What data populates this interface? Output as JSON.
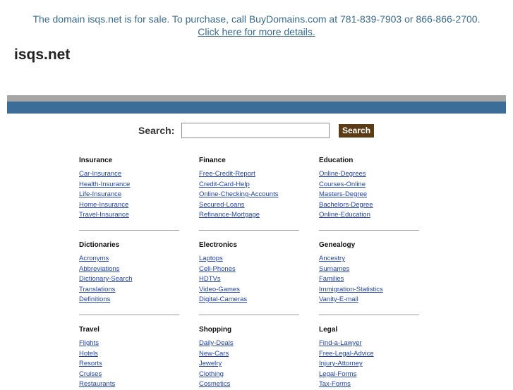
{
  "banner": {
    "text": "The domain isqs.net is for sale. To purchase, call BuyDomains.com at 781-839-7903 or 866-866-2700.",
    "link": "Click here for more details."
  },
  "domain": "isqs.net",
  "search": {
    "label": "Search:",
    "value": "",
    "button": "Search"
  },
  "categories": [
    {
      "title": "Insurance",
      "links": [
        "Car-Insurance",
        "Health-Insurance",
        "Life-Insurance",
        "Home-Insurance",
        "Travel-Insurance"
      ]
    },
    {
      "title": "Finance",
      "links": [
        "Free-Credit-Report",
        "Credit-Card-Help",
        "Online-Checking-Accounts",
        "Secured-Loans",
        "Refinance-Mortgage"
      ]
    },
    {
      "title": "Education",
      "links": [
        "Online-Degrees",
        "Courses-Online",
        "Masters-Degree",
        "Bachelors-Degree",
        "Online-Education"
      ]
    },
    {
      "title": "Dictionaries",
      "links": [
        "Acronyms",
        "Abbreviations",
        "Dictionary-Search",
        "Translations",
        "Definitions"
      ]
    },
    {
      "title": "Electronics",
      "links": [
        "Laptops",
        "Cell-Phones",
        "HDTVs",
        "Video-Games",
        "Digital-Cameras"
      ]
    },
    {
      "title": "Genealogy",
      "links": [
        "Ancestry",
        "Surnames",
        "Families",
        "Immigration-Statistics",
        "Vanity-E-mail"
      ]
    },
    {
      "title": "Travel",
      "links": [
        "Flights",
        "Hotels",
        "Resorts",
        "Cruises",
        "Restaurants"
      ]
    },
    {
      "title": "Shopping",
      "links": [
        "Daily-Deals",
        "New-Cars",
        "Jewelry",
        "Clothing",
        "Cosmetics"
      ]
    },
    {
      "title": "Legal",
      "links": [
        "Find-a-Lawyer",
        "Free-Legal-Advice",
        "Injury-Attorney",
        "Legal-Forms",
        "Tax-Forms"
      ]
    }
  ]
}
